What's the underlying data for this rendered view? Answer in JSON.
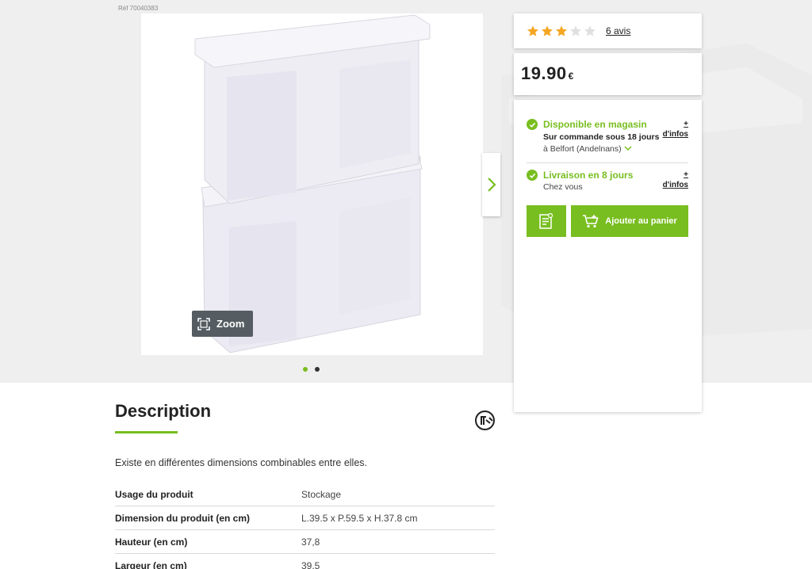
{
  "product": {
    "ref": "Réf 70040383",
    "zoom_label": "Zoom",
    "carousel_dots": 2,
    "active_dot": 0
  },
  "rating": {
    "stars": 3,
    "max_stars": 5,
    "reviews_label": "6 avis"
  },
  "price": {
    "amount": "19.90",
    "currency": "€"
  },
  "availability": {
    "store": {
      "title": "Disponible en magasin",
      "line1": "Sur commande sous 18 jours",
      "line2": "à Belfort (Andelnans)",
      "more_plus": "+",
      "more_label": "d'infos"
    },
    "delivery": {
      "title": "Livraison en 8 jours",
      "line1": "Chez vous",
      "more_plus": "+",
      "more_label": "d'infos"
    },
    "add_to_cart_label": "Ajouter au panier"
  },
  "description": {
    "title": "Description",
    "text": "Existe en différentes dimensions combinables entre elles.",
    "specs": [
      {
        "label": "Usage du produit",
        "value": "Stockage"
      },
      {
        "label": "Dimension du produit (en cm)",
        "value": "L.39.5 x P.59.5 x H.37.8 cm"
      },
      {
        "label": "Hauteur (en cm)",
        "value": "37,8"
      },
      {
        "label": "Largeur (en cm)",
        "value": "39,5"
      }
    ]
  },
  "colors": {
    "brand_green": "#78be20",
    "star": "#f5a623",
    "star_empty": "#e0e0e0"
  }
}
